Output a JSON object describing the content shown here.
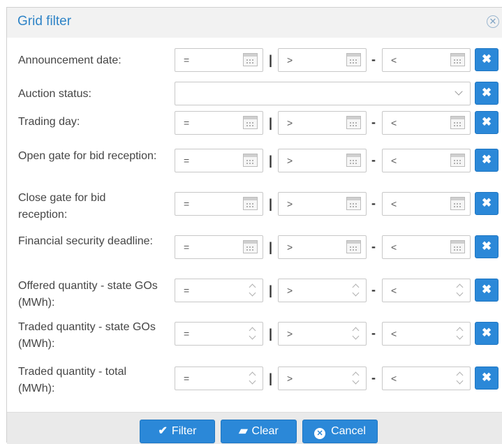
{
  "dialog": {
    "title": "Grid filter",
    "close_icon": "close-circle-icon"
  },
  "rows": [
    {
      "label": "Announcement date:",
      "kind": "date",
      "eq": "=",
      "gt": ">",
      "lt": "<"
    },
    {
      "label": "Auction status:",
      "kind": "select",
      "value": ""
    },
    {
      "label": "Trading day:",
      "kind": "date",
      "eq": "=",
      "gt": ">",
      "lt": "<"
    },
    {
      "label": "Open gate for bid reception:",
      "kind": "date",
      "eq": "=",
      "gt": ">",
      "lt": "<"
    },
    {
      "label": "Close gate for bid reception:",
      "kind": "date",
      "eq": "=",
      "gt": ">",
      "lt": "<"
    },
    {
      "label": "Financial security deadline:",
      "kind": "date",
      "eq": "=",
      "gt": ">",
      "lt": "<"
    },
    {
      "label": "Offered quantity - state GOs (MWh):",
      "kind": "number",
      "eq": "=",
      "gt": ">",
      "lt": "<"
    },
    {
      "label": "Traded quantity - state GOs (MWh):",
      "kind": "number",
      "eq": "=",
      "gt": ">",
      "lt": "<"
    },
    {
      "label": "Traded quantity - total (MWh):",
      "kind": "number",
      "eq": "=",
      "gt": ">",
      "lt": "<"
    }
  ],
  "separators": {
    "pipe": "|",
    "dash": "-"
  },
  "clear_glyph": "✖",
  "footer": {
    "filter_label": "Filter",
    "clear_label": "Clear",
    "cancel_label": "Cancel"
  }
}
